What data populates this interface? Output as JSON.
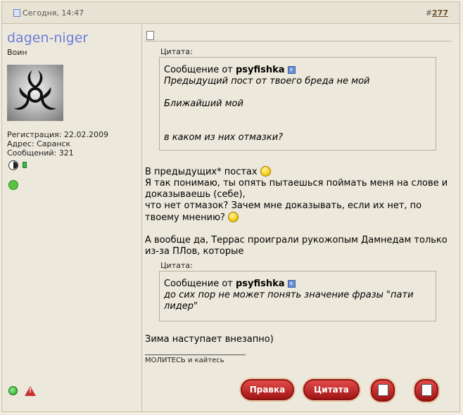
{
  "header": {
    "date": "Сегодня, 14:47",
    "post_number_prefix": "#",
    "post_number": "277"
  },
  "user": {
    "name": "dagen-niger",
    "title": "Воин",
    "registration": "Регистрация: 22.02.2009",
    "address": "Адрес: Саранск",
    "messages": "Сообщений: 321"
  },
  "post": {
    "quote_label": "Цитата:",
    "quote1": {
      "from_prefix": "Сообщение от ",
      "author": "psyfishka",
      "lines": [
        "Предыдущий пост от твоего бреда не мой",
        "Ближайший мой",
        "в каком из них отмазки?"
      ]
    },
    "para1": {
      "line1": "В предыдущих* постах",
      "line2": "Я так понимаю, ты опять пытаешься поймать меня на слове и",
      "line3": "доказываешь (себе),",
      "line4": "что нет отмазок? Зачем мне доказывать, если их нет, по",
      "line5": "твоему мнению?"
    },
    "para2": {
      "line1": "А вообще да, Террас проиграли рукожопым Дамнедам только",
      "line2": "из-за ПЛов, которые"
    },
    "quote2": {
      "from_prefix": "Сообщение от ",
      "author": "psyfishka",
      "lines": [
        "до сих пор не может понять значение фразы \"пати",
        "лидер\""
      ]
    },
    "closing": "Зима наступает внезапно)",
    "signature": "МОЛИТЕСЬ и кайтесь"
  },
  "buttons": {
    "edit": "Правка",
    "quote": "Цитата"
  },
  "icons": {
    "post_status": "document-icon",
    "reputation": "reputation-icon",
    "online": "online-status-icon",
    "report": "report-icon"
  }
}
